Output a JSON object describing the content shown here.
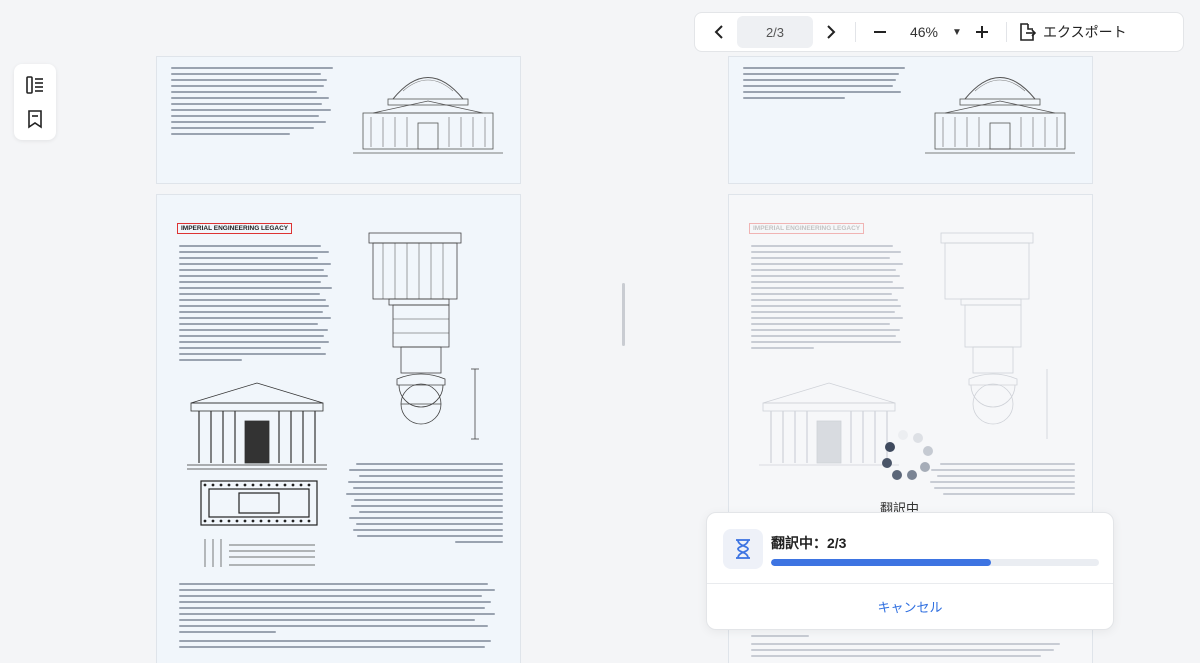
{
  "toolbar": {
    "page_indicator": "2/3",
    "zoom": "46%",
    "export_label": "エクスポート"
  },
  "document": {
    "section_heading": "IMPERIAL ENGINEERING LEGACY"
  },
  "progress": {
    "loading_text": "翻訳中",
    "title": "翻訳中：2/3",
    "fraction": 0.67,
    "cancel_label": "キャンセル"
  },
  "colors": {
    "accent": "#3d74e2",
    "page_bg": "#f1f6fb",
    "heading_border": "#dd3333"
  }
}
